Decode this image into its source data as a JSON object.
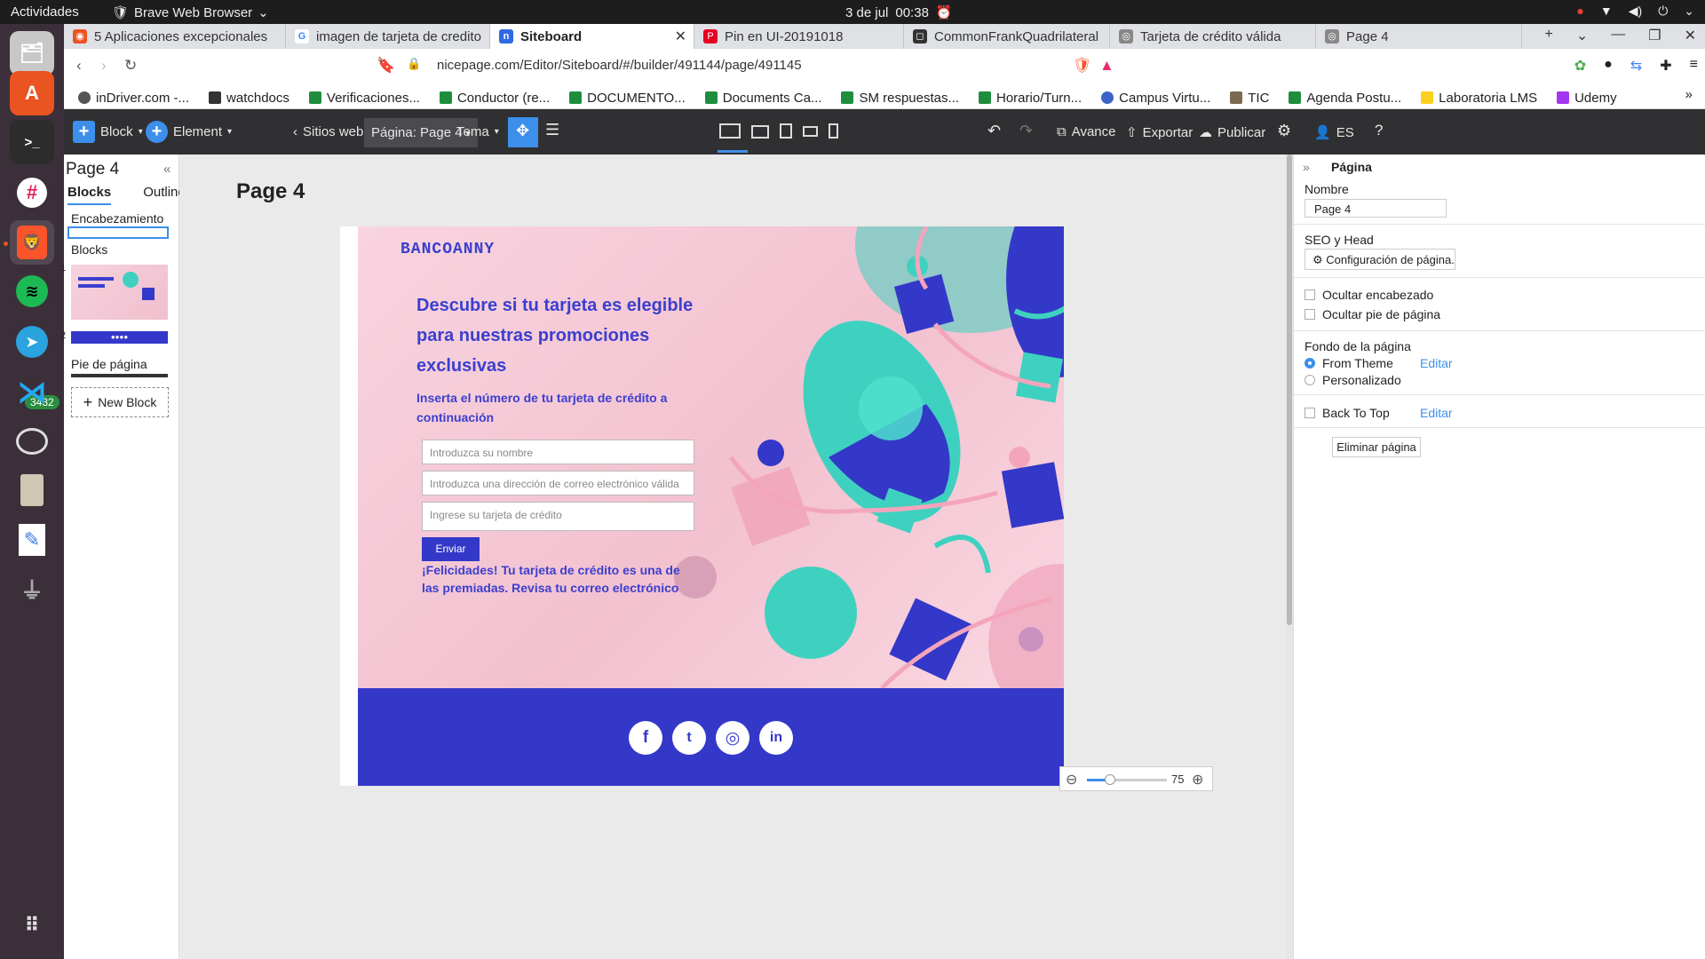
{
  "system": {
    "activities": "Actividades",
    "app_name": "Brave Web Browser",
    "date": "3 de jul",
    "time": "00:38"
  },
  "dock": {
    "telegram_badge": "3432"
  },
  "tabs": [
    {
      "label": "5 Aplicaciones excepcionales",
      "color": "#e95420"
    },
    {
      "label": "imagen de tarjeta de credito",
      "color": "#4285f4"
    },
    {
      "label": "Siteboard",
      "color": "#2d6ae3"
    },
    {
      "label": "Pin en UI-20191018",
      "color": "#e60023"
    },
    {
      "label": "CommonFrankQuadrilateral",
      "color": "#333333"
    },
    {
      "label": "Tarjeta de crédito válida",
      "color": "#666666"
    },
    {
      "label": "Page 4",
      "color": "#666666"
    }
  ],
  "address": {
    "url": "nicepage.com/Editor/Siteboard/#/builder/491144/page/491145"
  },
  "bookmarks": [
    "inDriver.com -...",
    "watchdocs",
    "Verificaciones...",
    "Conductor (re...",
    "DOCUMENTO...",
    "Documents Ca...",
    "SM respuestas...",
    "Horario/Turn...",
    "Campus Virtu...",
    "TIC",
    "Agenda Postu...",
    "Laboratoria LMS",
    "Udemy"
  ],
  "editor_toolbar": {
    "block": "Block",
    "element": "Element",
    "sites": "Sitios web",
    "page_selector": "Página: Page 4",
    "theme": "Tema",
    "preview": "Avance",
    "export": "Exportar",
    "publish": "Publicar",
    "language": "ES"
  },
  "left_panel": {
    "title": "Page 4",
    "tabs": [
      "Blocks",
      "Outline"
    ],
    "header_label": "Encabezamiento",
    "blocks_label": "Blocks",
    "block_numbers": [
      "1",
      "2"
    ],
    "footer_label": "Pie de página",
    "new_block": "New Block"
  },
  "canvas": {
    "page_heading": "Page 4",
    "logo": "BANCOANNY",
    "hero_heading": "Descubre si tu tarjeta es elegible para nuestras promociones exclusivas",
    "hero_subheading": "Inserta el número de tu tarjeta de crédito a continuación",
    "fields": [
      "Introduzca su nombre",
      "Introduzca una dirección de correo electrónico válida",
      "Ingrese su tarjeta de crédito"
    ],
    "send_button": "Enviar",
    "success_message": "¡Felicidades! Tu tarjeta de crédito es una de las premiadas. Revisa tu correo electrónico",
    "social": [
      {
        "name": "facebook-icon",
        "glyph": "f"
      },
      {
        "name": "twitter-icon",
        "glyph": "t"
      },
      {
        "name": "instagram-icon",
        "glyph": "◎"
      },
      {
        "name": "linkedin-icon",
        "glyph": "in"
      }
    ],
    "zoom_value": "75"
  },
  "right_panel": {
    "title": "Página",
    "name_label": "Nombre",
    "name_value": "Page 4",
    "seo_label": "SEO y Head",
    "seo_button": "Configuración de página...",
    "hide_header": "Ocultar encabezado",
    "hide_footer": "Ocultar pie de página",
    "background_label": "Fondo de la página",
    "from_theme": "From Theme",
    "custom": "Personalizado",
    "edit": "Editar",
    "back_to_top": "Back To Top",
    "delete_page": "Eliminar página"
  },
  "colors": {
    "brand_blue": "#3438c9",
    "accent_blue": "#3c8fea",
    "hero_pink": "#f3c1cf",
    "teal": "#3fd1c0"
  }
}
